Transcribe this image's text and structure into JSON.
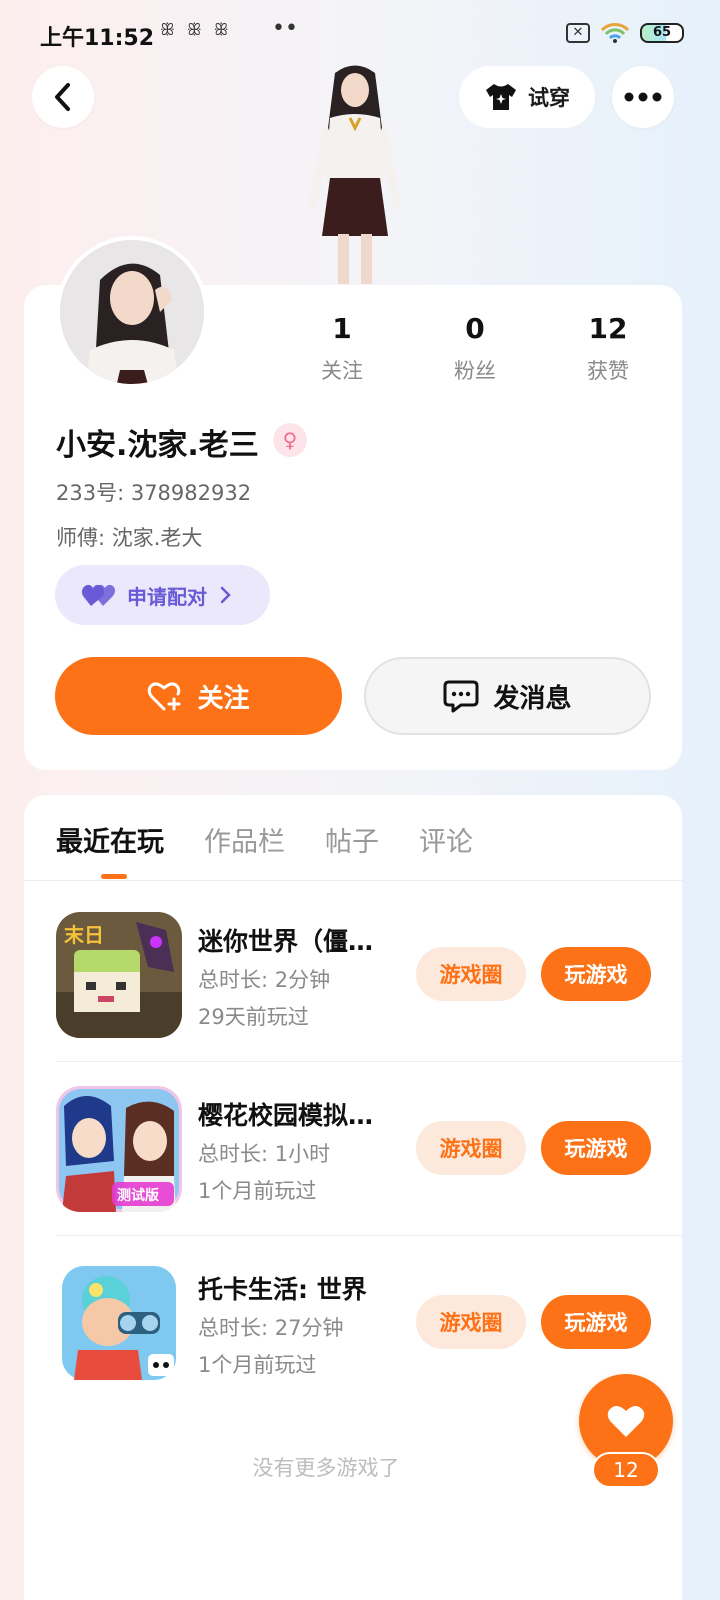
{
  "status_bar": {
    "time": "上午11:52",
    "notification_icons": "ꕥꕥꕥ",
    "dots": "••",
    "sim": "✕",
    "battery": "65"
  },
  "header": {
    "try_on_label": "试穿"
  },
  "profile": {
    "stats": [
      {
        "value": "1",
        "label": "关注"
      },
      {
        "value": "0",
        "label": "粉丝"
      },
      {
        "value": "12",
        "label": "获赞"
      }
    ],
    "name": "小安.沈家.老三",
    "gender_symbol": "♀",
    "uid": "233号: 378982932",
    "master": "师傅: 沈家.老大",
    "pair_label": "申请配对",
    "follow_label": "关注",
    "message_label": "发消息"
  },
  "tabs": [
    {
      "label": "最近在玩",
      "active": true
    },
    {
      "label": "作品栏",
      "active": false
    },
    {
      "label": "帖子",
      "active": false
    },
    {
      "label": "评论",
      "active": false
    }
  ],
  "games": [
    {
      "title": "迷你世界（僵…",
      "duration": "总时长: 2分钟",
      "last_played": "29天前玩过",
      "circle_label": "游戏圈",
      "play_label": "玩游戏"
    },
    {
      "title": "樱花校园模拟…",
      "duration": "总时长: 1小时",
      "last_played": "1个月前玩过",
      "circle_label": "游戏圈",
      "play_label": "玩游戏"
    },
    {
      "title": "托卡生活: 世界",
      "duration": "总时长: 27分钟",
      "last_played": "1个月前玩过",
      "circle_label": "游戏圈",
      "play_label": "玩游戏"
    }
  ],
  "game_icon_texts": [
    "末日",
    "测试版"
  ],
  "footer": {
    "no_more": "没有更多游戏了",
    "like_count": "12"
  },
  "colors": {
    "accent": "#fd7216",
    "pair_purple": "#6a5ad6",
    "pair_bg": "#ebe8fb"
  }
}
